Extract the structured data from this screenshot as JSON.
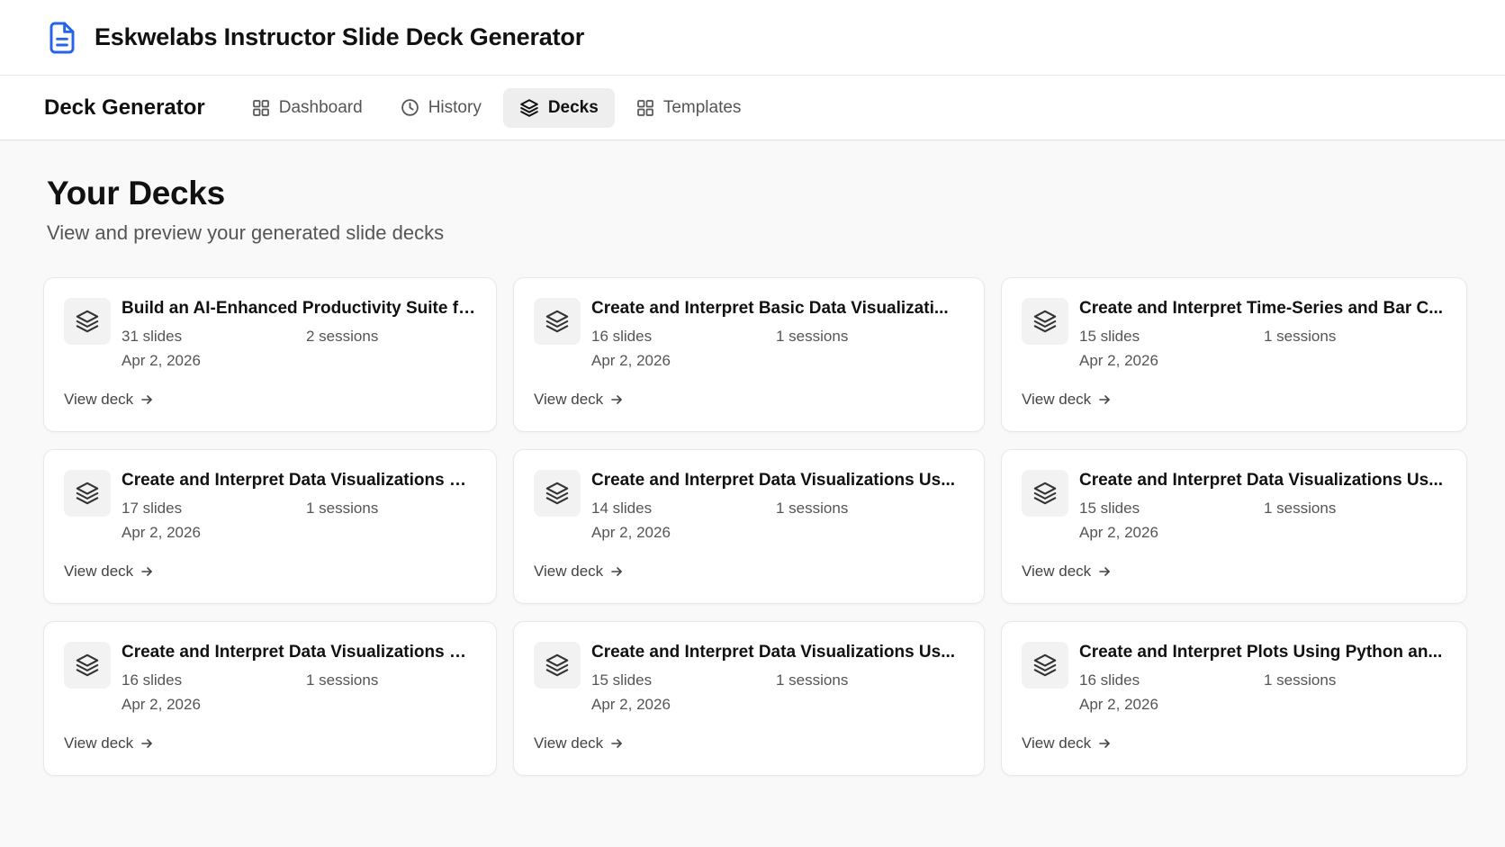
{
  "app": {
    "title": "Eskwelabs Instructor Slide Deck Generator"
  },
  "nav": {
    "brand": "Deck Generator",
    "items": [
      {
        "label": "Dashboard",
        "icon": "grid-icon",
        "active": false
      },
      {
        "label": "History",
        "icon": "clock-icon",
        "active": false
      },
      {
        "label": "Decks",
        "icon": "layers-icon",
        "active": true
      },
      {
        "label": "Templates",
        "icon": "grid-icon",
        "active": false
      }
    ]
  },
  "page": {
    "title": "Your Decks",
    "subtitle": "View and preview your generated slide decks"
  },
  "decks": [
    {
      "title": "Build an AI-Enhanced Productivity Suite for...",
      "slides": "31 slides",
      "sessions": "2 sessions",
      "date": "Apr 2, 2026",
      "action": "View deck"
    },
    {
      "title": "Create and Interpret Basic Data Visualizati...",
      "slides": "16 slides",
      "sessions": "1 sessions",
      "date": "Apr 2, 2026",
      "action": "View deck"
    },
    {
      "title": "Create and Interpret Time-Series and Bar C...",
      "slides": "15 slides",
      "sessions": "1 sessions",
      "date": "Apr 2, 2026",
      "action": "View deck"
    },
    {
      "title": "Create and Interpret Data Visualizations Us...",
      "slides": "17 slides",
      "sessions": "1 sessions",
      "date": "Apr 2, 2026",
      "action": "View deck"
    },
    {
      "title": "Create and Interpret Data Visualizations Us...",
      "slides": "14 slides",
      "sessions": "1 sessions",
      "date": "Apr 2, 2026",
      "action": "View deck"
    },
    {
      "title": "Create and Interpret Data Visualizations Us...",
      "slides": "15 slides",
      "sessions": "1 sessions",
      "date": "Apr 2, 2026",
      "action": "View deck"
    },
    {
      "title": "Create and Interpret Data Visualizations Us...",
      "slides": "16 slides",
      "sessions": "1 sessions",
      "date": "Apr 2, 2026",
      "action": "View deck"
    },
    {
      "title": "Create and Interpret Data Visualizations Us...",
      "slides": "15 slides",
      "sessions": "1 sessions",
      "date": "Apr 2, 2026",
      "action": "View deck"
    },
    {
      "title": "Create and Interpret Plots Using Python an...",
      "slides": "16 slides",
      "sessions": "1 sessions",
      "date": "Apr 2, 2026",
      "action": "View deck"
    }
  ],
  "colors": {
    "accent": "#2563eb",
    "background": "#f9f9f9",
    "card": "#ffffff",
    "active_tab": "#eeeeee"
  }
}
